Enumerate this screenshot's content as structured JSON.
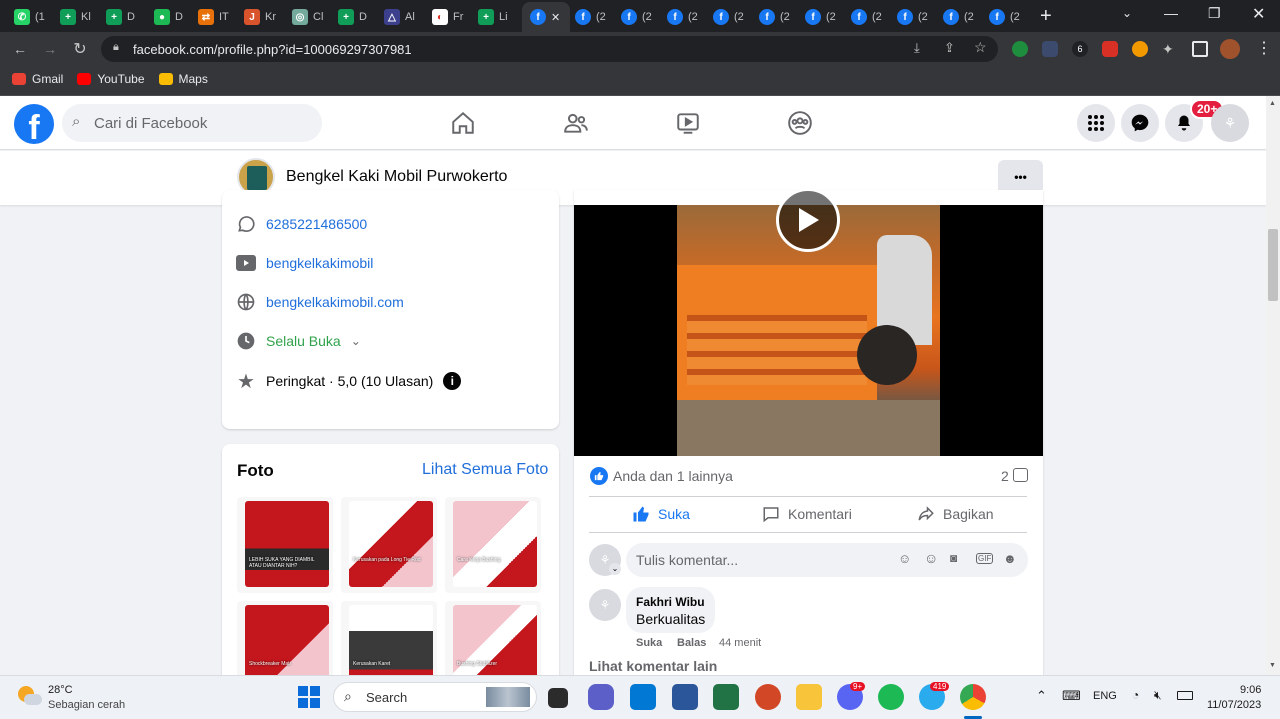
{
  "browser": {
    "tabs": [
      {
        "label": "(1",
        "color": "#25d366",
        "glyph": "✆"
      },
      {
        "label": "Kl",
        "color": "#0f9d58",
        "glyph": "+"
      },
      {
        "label": "D",
        "color": "#0f9d58",
        "glyph": "+"
      },
      {
        "label": "D",
        "color": "#1db954",
        "glyph": "●"
      },
      {
        "label": "IT",
        "color": "#e8710a",
        "glyph": "⇄"
      },
      {
        "label": "Kr",
        "color": "#d9532c",
        "glyph": "J"
      },
      {
        "label": "Cl",
        "color": "#74aa9c",
        "glyph": "◎"
      },
      {
        "label": "D",
        "color": "#0f9d58",
        "glyph": "+"
      },
      {
        "label": "Al",
        "color": "#3b3f8c",
        "glyph": "△"
      },
      {
        "label": "Fr",
        "color": "#ffffff",
        "glyph": "◐"
      },
      {
        "label": "Li",
        "color": "#0f9d58",
        "glyph": "+"
      }
    ],
    "active_tab_close": "✕",
    "fb_tabs": [
      "(2",
      "(2",
      "(2",
      "(2",
      "(2",
      "(2",
      "(2",
      "(2",
      "(2",
      "(2"
    ],
    "new_tab": "+",
    "url": "facebook.com/profile.php?id=100069297307981",
    "bookmarks": [
      {
        "label": "Gmail",
        "color": "#ea4335"
      },
      {
        "label": "YouTube",
        "color": "#ff0000"
      },
      {
        "label": "Maps",
        "color": "#fbbc04"
      }
    ]
  },
  "facebook": {
    "search_placeholder": "Cari di Facebook",
    "notification_badge": "20+",
    "page_name": "Bengkel Kaki Mobil Purwokerto",
    "more_button": "•••",
    "intro": {
      "whatsapp": "6285221486500",
      "youtube": "bengkelkakimobil",
      "website": "bengkelkakimobil.com",
      "hours": "Selalu Buka",
      "rating": "Peringkat · 5,0 (10 Ulasan)"
    },
    "photos": {
      "title": "Foto",
      "see_all": "Lihat Semua Foto",
      "items": [
        {
          "caption": "LEBIH SUKA YANG DIAMBIL ATAU DIANTAR NIH?"
        },
        {
          "caption": "Kerusakan pada Long Tie Rod"
        },
        {
          "caption": "Cara Kerja Bushing"
        },
        {
          "caption": "Shockbreaker Mati"
        },
        {
          "caption": "Kerusakan Karet"
        },
        {
          "caption": "Bushing Stabilizer"
        }
      ]
    },
    "post": {
      "reactions_text": "Anda dan 1 lainnya",
      "comment_count": "2",
      "actions": {
        "like": "Suka",
        "comment": "Komentari",
        "share": "Bagikan"
      },
      "comment_placeholder": "Tulis komentar...",
      "comment": {
        "author": "Fakhri Wibu",
        "text": "Berkualitas",
        "like": "Suka",
        "reply": "Balas",
        "time": "44 menit"
      },
      "more_comments": "Lihat komentar lain"
    }
  },
  "taskbar": {
    "weather_temp": "28°C",
    "weather_desc": "Sebagian cerah",
    "search": "Search",
    "discord_badge": "9+",
    "telegram_badge": "419",
    "lang": "ENG",
    "time": "9:06",
    "date": "11/07/2023"
  }
}
